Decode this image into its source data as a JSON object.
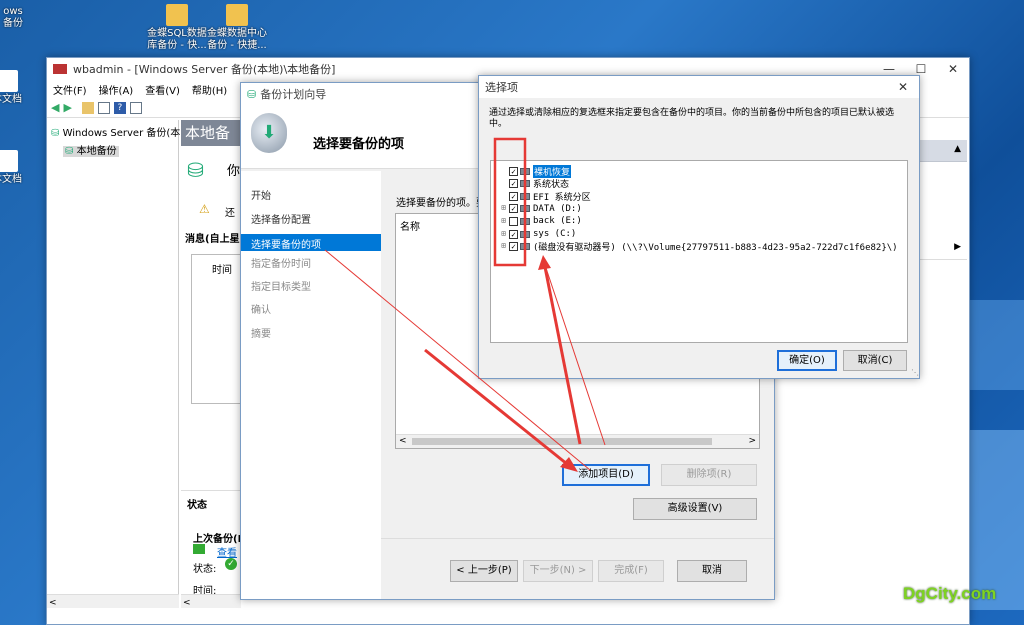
{
  "desktop": {
    "icons": [
      {
        "label": "ows\n备份"
      },
      {
        "label": "本文档"
      },
      {
        "label": "本文档"
      },
      {
        "label": "金蝶SQL数据\n库备份 - 快..."
      },
      {
        "label": "金蝶数据中心\n备份 - 快捷..."
      }
    ]
  },
  "wbadmin": {
    "title": "wbadmin - [Windows Server 备份(本地)\\本地备份]",
    "menu": [
      "文件(F)",
      "操作(A)",
      "查看(V)",
      "帮助(H)"
    ],
    "tree_root": "Windows Server 备份(本",
    "tree_child": "本地备份",
    "main_header": "本地备",
    "you_text": "你",
    "warn_text": "还",
    "messages_title": "消息(自上星",
    "time_col": "时间",
    "status_section": "状态",
    "last_backup": "上次备份(L",
    "status_label": "状态:",
    "time_label": "时间:",
    "view_link": "查看"
  },
  "wizard": {
    "title": "备份计划向导",
    "heading": "选择要备份的项",
    "nav": [
      {
        "label": "开始",
        "active": false,
        "dim": false
      },
      {
        "label": "选择备份配置",
        "active": false,
        "dim": false
      },
      {
        "label": "选择要备份的项",
        "active": true,
        "dim": false
      },
      {
        "label": "指定备份时间",
        "active": false,
        "dim": true
      },
      {
        "label": "指定目标类型",
        "active": false,
        "dim": true
      },
      {
        "label": "确认",
        "active": false,
        "dim": true
      },
      {
        "label": "摘要",
        "active": false,
        "dim": true
      }
    ],
    "instruction": "选择要备份的项。要",
    "list_header": "名称",
    "add_item": "添加项目(D)",
    "remove_item": "删除项(R)",
    "advanced": "高级设置(V)",
    "prev": "< 上一步(P)",
    "next": "下一步(N) >",
    "finish": "完成(F)",
    "cancel": "取消"
  },
  "dialog": {
    "title": "选择项",
    "description": "通过选择或清除相应的复选框来指定要包含在备份中的项目。你的当前备份中所包含的项目已默认被选中。",
    "items": [
      {
        "label": "裸机恢复",
        "checked": true,
        "expander": false,
        "selected": true
      },
      {
        "label": "系统状态",
        "checked": true,
        "expander": false,
        "selected": false
      },
      {
        "label": "EFI 系统分区",
        "checked": true,
        "expander": false,
        "selected": false
      },
      {
        "label": "DATA (D:)",
        "checked": true,
        "expander": true,
        "selected": false
      },
      {
        "label": "back (E:)",
        "checked": false,
        "expander": true,
        "selected": false
      },
      {
        "label": "sys (C:)",
        "checked": true,
        "expander": true,
        "selected": false
      },
      {
        "label": "(磁盘没有驱动器号) (\\\\?\\Volume{27797511-b883-4d23-95a2-722d7c1f6e82}\\)",
        "checked": true,
        "expander": true,
        "selected": false
      }
    ],
    "ok": "确定(O)",
    "cancel": "取消(C)"
  },
  "watermark": "DgCity.com",
  "colors": {
    "highlight": "#0078d7",
    "annotation_red": "#e53935",
    "watermark": "#7ed321"
  }
}
